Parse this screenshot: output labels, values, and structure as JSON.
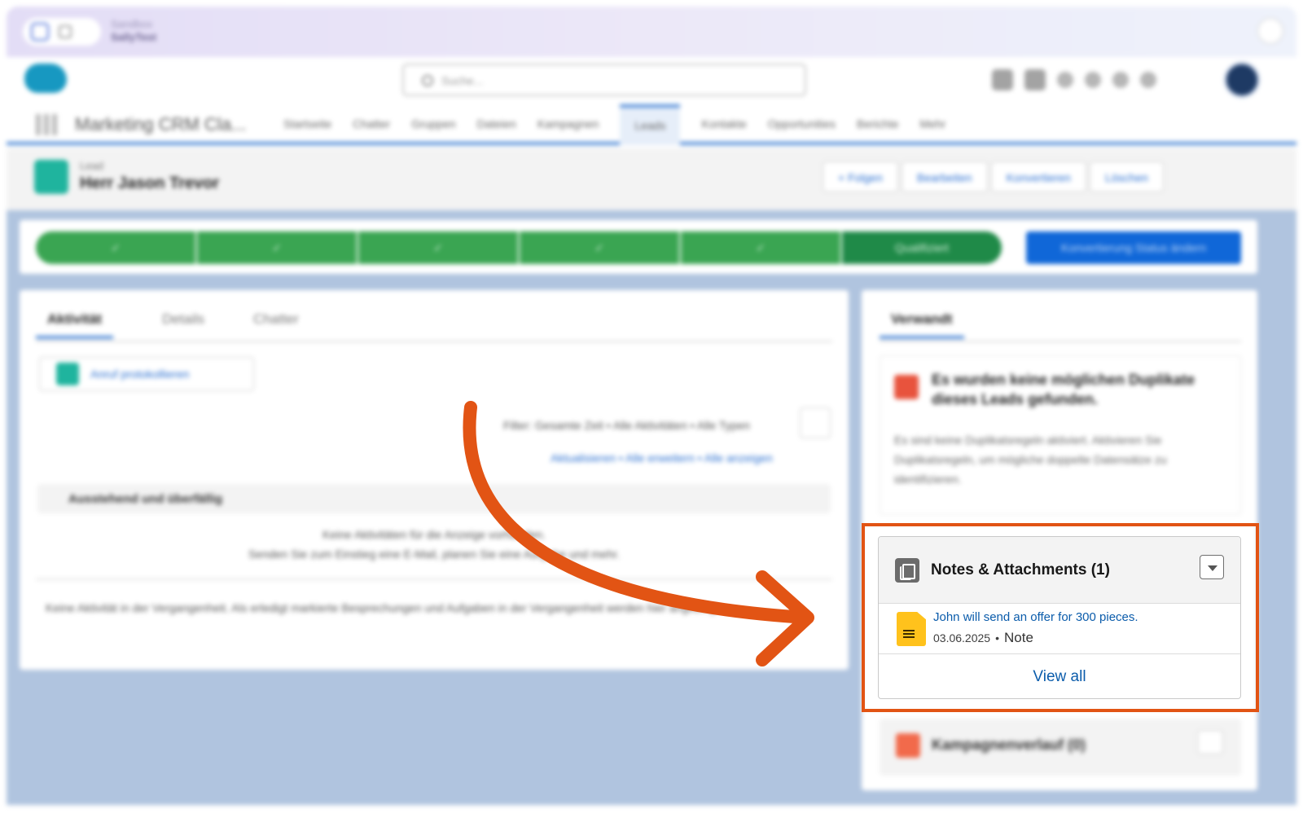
{
  "browser": {
    "sandbox_label": "Sandbox",
    "sandbox_name": "SallyTest"
  },
  "header": {
    "search_placeholder": "Suche..."
  },
  "nav": {
    "app_name": "Marketing CRM Cla...",
    "items": [
      "Startseite",
      "Chatter",
      "Gruppen",
      "Dateien",
      "Kampagnen",
      "Leads",
      "Kontakte",
      "Opportunities",
      "Berichte",
      "Mehr"
    ],
    "active": "Leads"
  },
  "record": {
    "type": "Lead",
    "name": "Herr Jason Trevor",
    "buttons": [
      "+ Folgen",
      "Bearbeiten",
      "Konvertieren",
      "Löschen"
    ]
  },
  "path": {
    "steps": [
      "✓",
      "✓",
      "✓",
      "✓",
      "✓",
      "Qualifiziert"
    ],
    "action_button": "Konvertierung Status ändern"
  },
  "activity": {
    "tabs": [
      "Aktivität",
      "Details",
      "Chatter"
    ],
    "log_call": "Anruf protokollieren",
    "filter": "Filter: Gesamte Zeit • Alle Aktivitäten • Alle Typen",
    "links": "Aktualisieren • Alle erweitern • Alle anzeigen",
    "section_title": "Ausstehend und überfällig",
    "empty_line1": "Keine Aktivitäten für die Anzeige vorhanden.",
    "empty_line2": "Senden Sie zum Einstieg eine E-Mail, planen Sie eine Aufgabe und mehr.",
    "past_text": "Keine Aktivität in der Vergangenheit. Als erledigt markierte Besprechungen und Aufgaben in der Vergangenheit werden hier angezeigt."
  },
  "related": {
    "tab": "Verwandt",
    "duplicates_title": "Es wurden keine möglichen Duplikate dieses Leads gefunden.",
    "duplicates_body": "Es sind keine Duplikatsregeln aktiviert. Aktivieren Sie Duplikatsregeln, um mögliche doppelte Datensätze zu identifizieren.",
    "campaign_title": "Kampagnenverlauf (0)"
  },
  "notes": {
    "title": "Notes & Attachments (1)",
    "item_title": "John will send an offer for 300 pieces.",
    "item_date": "03.06.2025",
    "item_separator": "•",
    "item_type": "Note",
    "view_all": "View all"
  },
  "colors": {
    "highlight": "#e25414",
    "link": "#0b5cab",
    "path_green": "#3aa552",
    "brand_blue": "#1067d8"
  }
}
